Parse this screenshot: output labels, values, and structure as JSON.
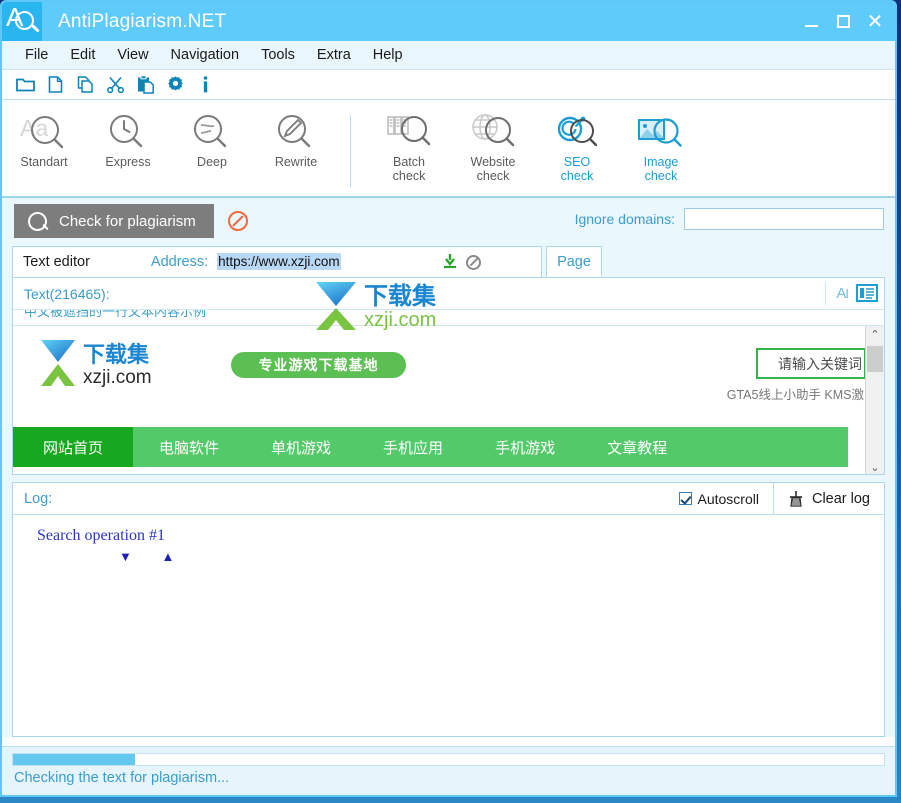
{
  "window": {
    "title": "AntiPlagiarism.NET",
    "app_icon": "magnifier-a-icon",
    "controls": {
      "minimize": "minimize-icon",
      "maximize": "maximize-icon",
      "close": "close-icon"
    }
  },
  "menubar": {
    "items": [
      {
        "label": "File"
      },
      {
        "label": "Edit"
      },
      {
        "label": "View"
      },
      {
        "label": "Navigation"
      },
      {
        "label": "Tools"
      },
      {
        "label": "Extra"
      },
      {
        "label": "Help"
      }
    ]
  },
  "icon_toolbar": {
    "items": [
      {
        "icon": "open-folder-icon"
      },
      {
        "icon": "new-file-icon"
      },
      {
        "icon": "copy-icon"
      },
      {
        "icon": "cut-scissors-icon"
      },
      {
        "icon": "paste-icon"
      },
      {
        "icon": "gear-icon"
      },
      {
        "icon": "info-icon"
      }
    ]
  },
  "modes": {
    "left_group": [
      {
        "label": "Standart",
        "icon": "aa-magnifier-icon",
        "active": false
      },
      {
        "label": "Express",
        "icon": "clock-magnifier-icon",
        "active": false
      },
      {
        "label": "Deep",
        "icon": "lines-magnifier-icon",
        "active": false
      },
      {
        "label": "Rewrite",
        "icon": "pencil-magnifier-icon",
        "active": false
      }
    ],
    "right_group": [
      {
        "label": "Batch\ncheck",
        "line1": "Batch",
        "line2": "check",
        "icon": "files-magnifier-icon",
        "active": false
      },
      {
        "label": "Website\ncheck",
        "line1": "Website",
        "line2": "check",
        "icon": "globe-magnifier-icon",
        "active": false
      },
      {
        "label": "SEO\ncheck",
        "line1": "SEO",
        "line2": "check",
        "icon": "seo-magnifier-icon",
        "active": true
      },
      {
        "label": "Image\ncheck",
        "line1": "Image",
        "line2": "check",
        "icon": "image-magnifier-icon",
        "active": true
      }
    ]
  },
  "check_bar": {
    "button_label": "Check for plagiarism",
    "button_icon": "magnifier-icon",
    "stop_icon": "stop-forbidden-icon",
    "ignore_domains_label": "Ignore domains:",
    "ignore_domains_value": "",
    "ignore_domains_placeholder": ""
  },
  "editor": {
    "panel_title": "Text editor",
    "address_label": "Address:",
    "address_value": "https://www.xzji.com",
    "download_icon": "download-icon",
    "cancel_icon": "forbidden-icon",
    "tab_label": "Page",
    "text_counter": "Text(216465):",
    "ai_icon": "ai-text-cursor-icon",
    "list_icon": "list-view-icon",
    "clipped_text": "中文被遮挡的一行文本内容示例"
  },
  "webpage": {
    "logo_text_cn": "下载集",
    "logo_text_domain": "xzji.com",
    "badge_text": "专业游戏下载基地",
    "search_placeholder": "请输入关键词",
    "hotwords": "GTA5线上小助手  KMS激",
    "nav_items": [
      {
        "label": "网站首页",
        "active": true
      },
      {
        "label": "电脑软件",
        "active": false
      },
      {
        "label": "单机游戏",
        "active": false
      },
      {
        "label": "手机应用",
        "active": false
      },
      {
        "label": "手机游戏",
        "active": false
      },
      {
        "label": "文章教程",
        "active": false
      }
    ],
    "scroll_up_icon": "chevron-up-icon",
    "scroll_down_icon": "chevron-down-icon",
    "scroll_left_icon": "chevron-left-icon",
    "scroll_right_icon": "chevron-right-icon"
  },
  "log": {
    "label": "Log:",
    "autoscroll_label": "Autoscroll",
    "autoscroll_checked": true,
    "clear_log_label": "Clear log",
    "clear_log_icon": "broom-icon",
    "entries": [
      "Search operation #1"
    ],
    "markers": "▼ ▲"
  },
  "status": {
    "progress_percent": 14,
    "message": "Checking the text for plagiarism..."
  },
  "colors": {
    "title_bar": "#5ecbfb",
    "accent": "#3b9ccd",
    "button_grey": "#7d7d7d",
    "nav_green": "#54c96a",
    "nav_green_active": "#17a81f",
    "progress": "#63c8f0",
    "log_text": "#2b35c9",
    "stop_orange": "#ef6a3d"
  }
}
